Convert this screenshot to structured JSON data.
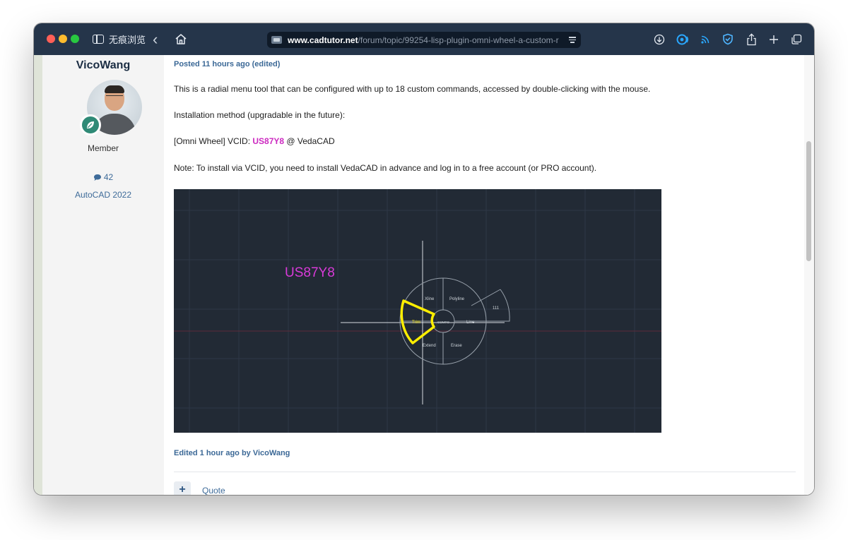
{
  "toolbar": {
    "private_label": "无痕浏览",
    "url_host": "www.cadtutor.net",
    "url_path": "/forum/topic/99254-lisp-plugin-omni-wheel-a-custom-r"
  },
  "author": {
    "name": "VicoWang",
    "rank": "Member",
    "post_count": "42",
    "version": "AutoCAD 2022"
  },
  "post": {
    "meta": "Posted 11 hours ago (edited)",
    "intro": "This is a radial menu tool that can be configured with up to 18 custom commands, accessed by double-clicking with the mouse.",
    "install_heading": "Installation method (upgradable in the future):",
    "vcid_prefix": "[Omni Wheel] VCID: ",
    "vcid_code": "US87Y8",
    "vcid_suffix": " @ VedaCAD",
    "note": "Note: To install via VCID, you need to install VedaCAD in advance and log in to a free account (or PRO account).",
    "edited_by": "Edited 1 hour ago by VicoWang",
    "quote_label": "Quote",
    "plus_label": "+"
  },
  "cad": {
    "code_text": "US87Y8",
    "center": "COMPO",
    "segments": {
      "xline": "Xline",
      "polyline": "Polyline",
      "trim": "Trim",
      "line": "Line",
      "extend": "Extend",
      "erase": "Erase",
      "extra": "111"
    },
    "colors": {
      "background": "#222a35",
      "highlight": "#ffee00",
      "code": "#d93ad9",
      "wheel": "#9aa3ad"
    }
  }
}
